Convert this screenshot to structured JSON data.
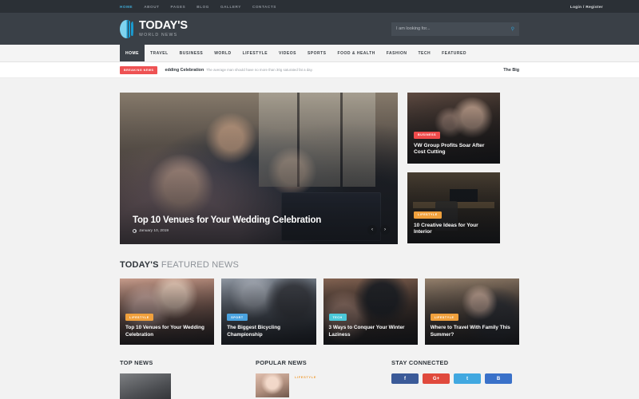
{
  "topbar": {
    "nav": [
      {
        "label": "HOME",
        "active": true
      },
      {
        "label": "ABOUT",
        "active": false
      },
      {
        "label": "PAGES",
        "active": false
      },
      {
        "label": "BLOG",
        "active": false
      },
      {
        "label": "GALLERY",
        "active": false
      },
      {
        "label": "CONTACTS",
        "active": false
      }
    ],
    "auth": "Login / Register"
  },
  "header": {
    "brand_title": "TODAY'S",
    "brand_subtitle": "WORLD NEWS",
    "search_placeholder": "I am looking for...",
    "search_value": "",
    "search_icon": "search-icon"
  },
  "mainnav": {
    "items": [
      {
        "label": "HOME",
        "active": true
      },
      {
        "label": "TRAVEL",
        "active": false
      },
      {
        "label": "BUSINESS",
        "active": false
      },
      {
        "label": "WORLD",
        "active": false
      },
      {
        "label": "LIFESTYLE",
        "active": false
      },
      {
        "label": "VIDEOS",
        "active": false
      },
      {
        "label": "SPORTS",
        "active": false
      },
      {
        "label": "FOOD & HEALTH",
        "active": false
      },
      {
        "label": "FASHION",
        "active": false
      },
      {
        "label": "TECH",
        "active": false
      },
      {
        "label": "FEATURED",
        "active": false
      }
    ]
  },
  "breaking": {
    "badge": "BREAKING NEWS",
    "headline": "edding Celebration",
    "body": "The average man should have no more than 30g saturated fat a day.",
    "right": "The Big"
  },
  "hero": {
    "title": "Top 10 Venues for Your Wedding Celebration",
    "date": "January 10, 2019",
    "prev": "‹",
    "next": "›"
  },
  "side_cards": [
    {
      "category": "BUSINESS",
      "category_color": "#ee4b4b",
      "title": "VW Group Profits Soar After Cost Cutting"
    },
    {
      "category": "LIFESTYLE",
      "category_color": "#f0a03c",
      "title": "10 Creative Ideas for Your Interior"
    }
  ],
  "featured_section": {
    "title_bold": "TODAY'S",
    "title_light": "FEATURED NEWS",
    "cards": [
      {
        "category": "LIFESTYLE",
        "category_color": "#f0a03c",
        "title": "Top 10 Venues for Your Wedding Celebration"
      },
      {
        "category": "SPORT",
        "category_color": "#4aa3e0",
        "title": "The Biggest Bicycling Championship"
      },
      {
        "category": "TECH",
        "category_color": "#4bc8d8",
        "title": "3 Ways to Conquer Your Winter Laziness"
      },
      {
        "category": "LIFESTYLE",
        "category_color": "#f0a03c",
        "title": "Where to Travel With Family This Summer?"
      }
    ]
  },
  "bottom": {
    "top_news_title": "TOP NEWS",
    "popular_news_title": "POPULAR NEWS",
    "stay_connected_title": "STAY CONNECTED",
    "popular_item_category": "LIFESTYLE",
    "social": [
      {
        "name": "facebook-icon",
        "glyph": "f",
        "color": "#3b5a98"
      },
      {
        "name": "google-plus-icon",
        "glyph": "G+",
        "color": "#e0493c"
      },
      {
        "name": "twitter-icon",
        "glyph": "t",
        "color": "#41a8e0"
      },
      {
        "name": "behance-icon",
        "glyph": "B",
        "color": "#3a71c9"
      }
    ]
  }
}
